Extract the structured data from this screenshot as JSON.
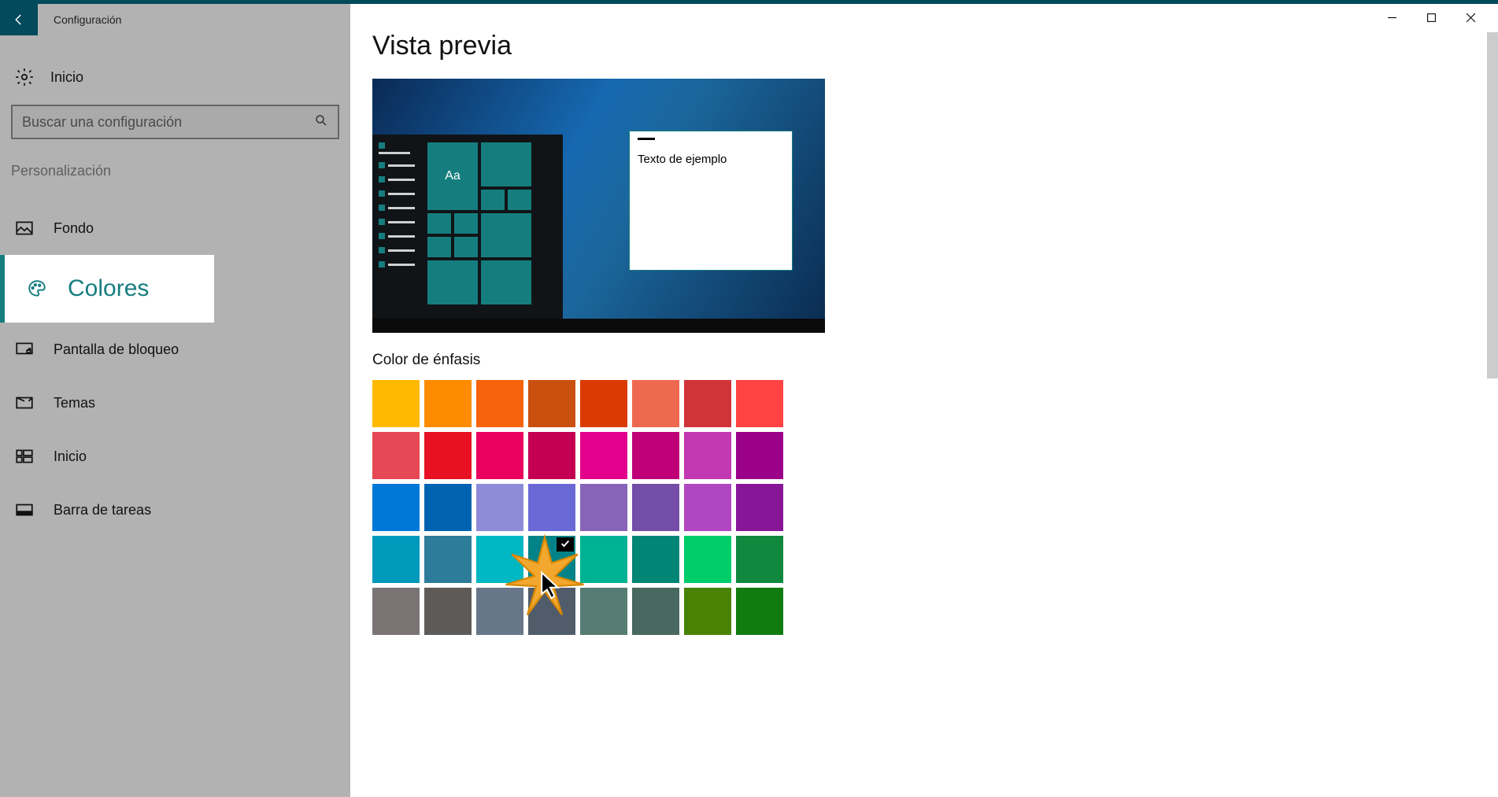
{
  "titlebar": {
    "title": "Configuración"
  },
  "sidebar": {
    "home_label": "Inicio",
    "search_placeholder": "Buscar una configuración",
    "section_label": "Personalización",
    "items": [
      {
        "label": "Fondo"
      },
      {
        "label": "Colores"
      },
      {
        "label": "Pantalla de bloqueo"
      },
      {
        "label": "Temas"
      },
      {
        "label": "Inicio"
      },
      {
        "label": "Barra de tareas"
      }
    ]
  },
  "main": {
    "preview_heading": "Vista previa",
    "preview_sample_text": "Texto de ejemplo",
    "preview_tile_text": "Aa",
    "accent_label": "Color de énfasis",
    "selected_color_index": 27,
    "colors": [
      "#ffb900",
      "#ff8c00",
      "#f7630c",
      "#ca5010",
      "#da3b01",
      "#ef6950",
      "#d13438",
      "#ff4343",
      "#e74856",
      "#e81123",
      "#ea005e",
      "#c30052",
      "#e3008c",
      "#bf0077",
      "#c239b3",
      "#9a0089",
      "#0078d7",
      "#0063b1",
      "#8e8cd8",
      "#6b69d6",
      "#8764b8",
      "#744da9",
      "#b146c2",
      "#881798",
      "#0099bc",
      "#2d7d9a",
      "#00b7c3",
      "#038387",
      "#00b294",
      "#018574",
      "#00cc6a",
      "#10893e",
      "#7a7574",
      "#5d5a58",
      "#68768a",
      "#515c6b",
      "#567c73",
      "#486860",
      "#498205",
      "#107c10"
    ]
  }
}
